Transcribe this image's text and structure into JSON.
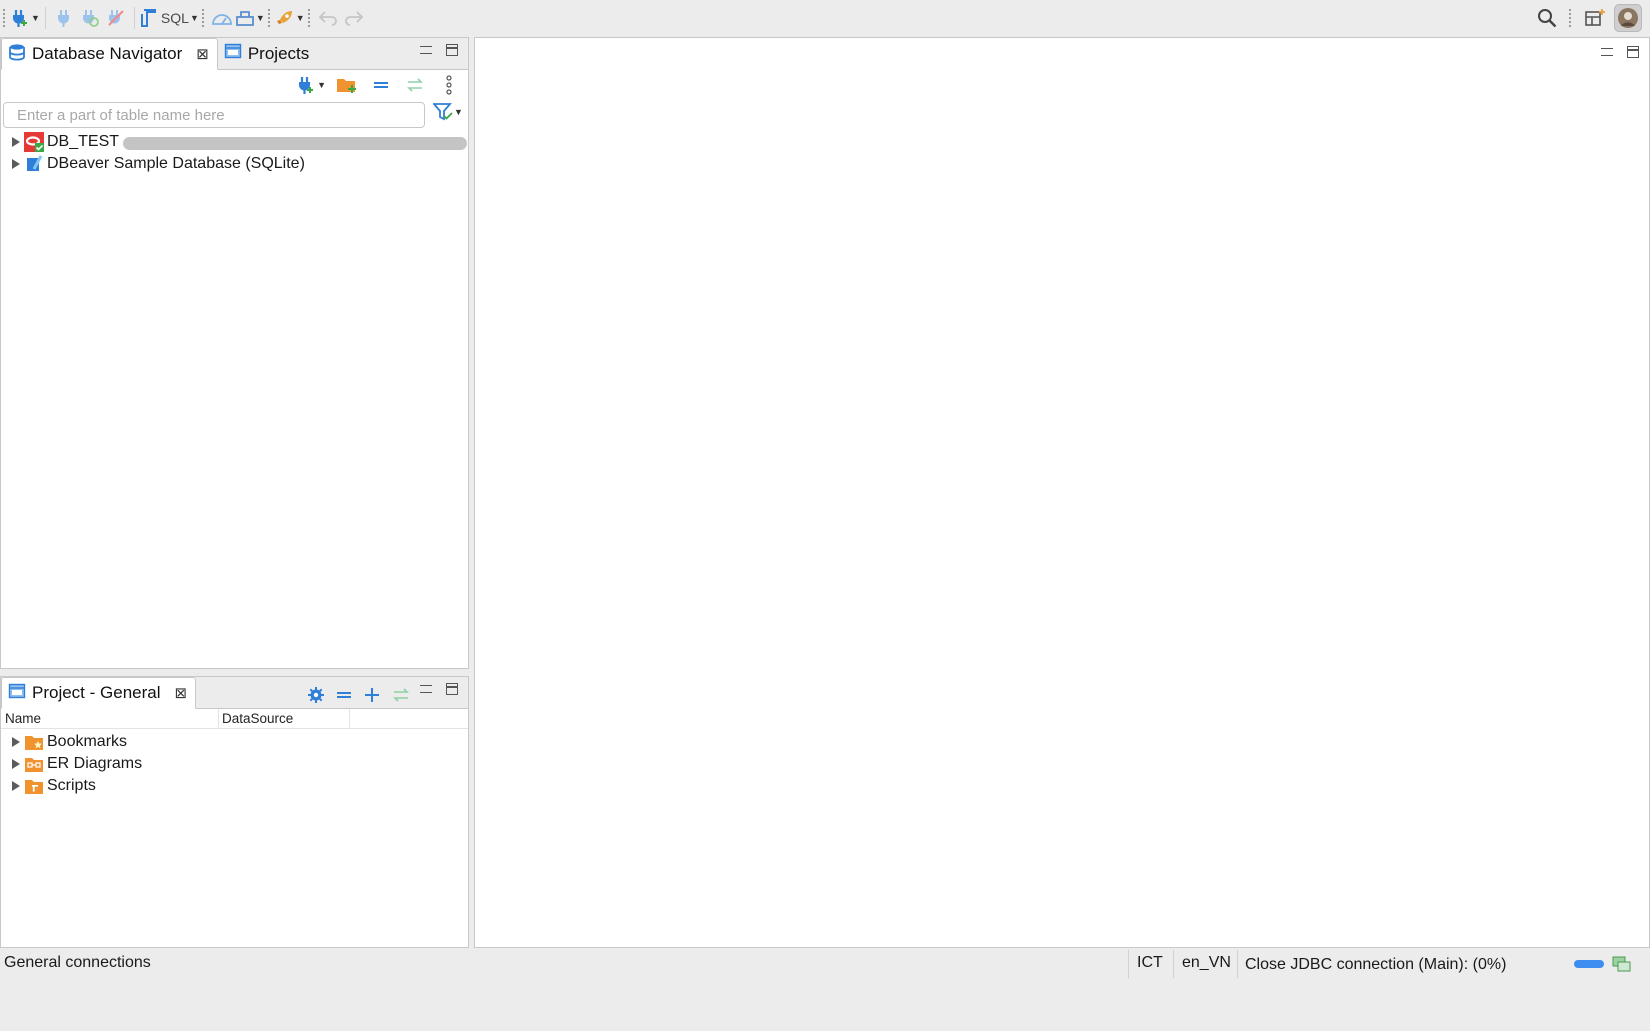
{
  "toolbar": {
    "sql_label": "SQL",
    "icons": [
      "new-connection-icon",
      "connect-icon",
      "reconnect-icon",
      "disconnect-icon",
      "sql-editor-icon",
      "dashboard-icon",
      "task-icon",
      "launch-icon",
      "back-icon",
      "forward-icon",
      "search-icon",
      "perspective-icon",
      "avatar"
    ]
  },
  "navigator": {
    "tabs": [
      {
        "label": "Database Navigator",
        "active": true
      },
      {
        "label": "Projects",
        "active": false
      }
    ],
    "filter": {
      "placeholder": "Enter a part of table name here",
      "value": ""
    },
    "tree": [
      {
        "label": "DB_TEST",
        "icon": "oracle-connection-icon",
        "redacted": true
      },
      {
        "label": "DBeaver Sample Database (SQLite)",
        "icon": "sqlite-icon"
      }
    ]
  },
  "project": {
    "tab_label": "Project - General",
    "columns": [
      "Name",
      "DataSource"
    ],
    "items": [
      {
        "label": "Bookmarks",
        "icon": "bookmarks-folder-icon"
      },
      {
        "label": "ER Diagrams",
        "icon": "er-diagrams-folder-icon"
      },
      {
        "label": "Scripts",
        "icon": "scripts-folder-icon"
      }
    ]
  },
  "status": {
    "left": "General connections",
    "timezone": "ICT",
    "locale": "en_VN",
    "task": "Close JDBC connection (Main): (0%)"
  },
  "colors": {
    "accent_blue": "#3d8ef0",
    "folder_orange": "#f0932f",
    "oracle_red": "#e53935",
    "background": "#ececec"
  }
}
